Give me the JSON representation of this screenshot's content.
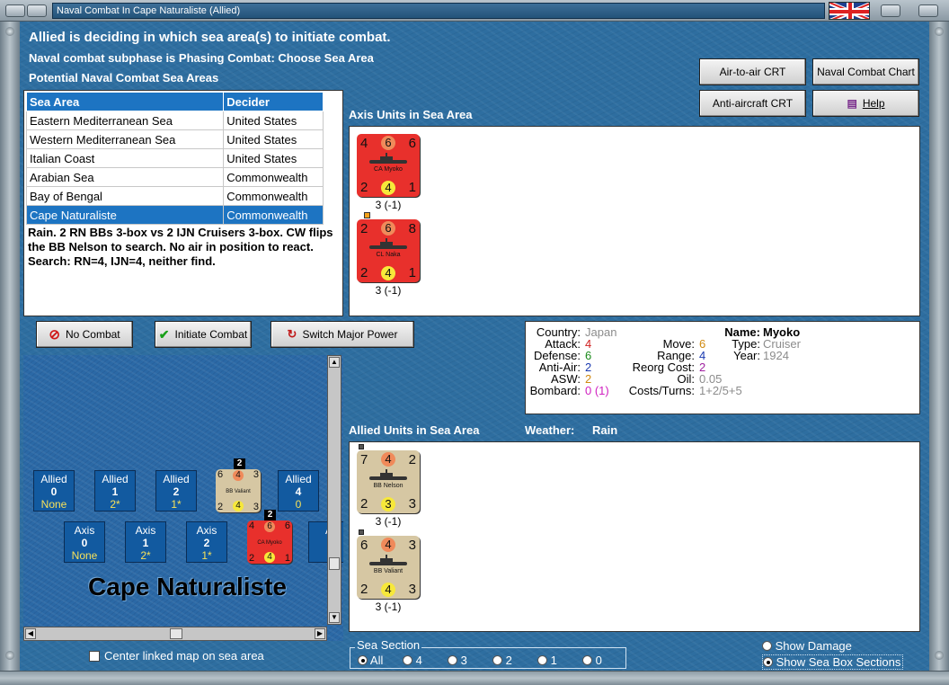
{
  "window": {
    "title": "Naval Combat In Cape Naturaliste (Allied)"
  },
  "header": {
    "line1": "Allied is deciding in which sea area(s) to initiate combat.",
    "line2": "Naval combat subphase is Phasing Combat: Choose Sea Area",
    "line3": "Potential Naval Combat Sea Areas"
  },
  "buttons": {
    "air_to_air": "Air-to-air CRT",
    "naval_chart": "Naval Combat Chart",
    "anti_aircraft": "Anti-aircraft CRT",
    "help": "Help",
    "no_combat": "No Combat",
    "initiate_combat": "Initiate Combat",
    "switch_major": "Switch Major Power"
  },
  "sea_table": {
    "headers": [
      "Sea Area",
      "Decider"
    ],
    "rows": [
      [
        "Eastern Mediterranean Sea",
        "United States"
      ],
      [
        "Western Mediterranean Sea",
        "United States"
      ],
      [
        "Italian Coast",
        "United States"
      ],
      [
        "Arabian Sea",
        "Commonwealth"
      ],
      [
        "Bay of Bengal",
        "Commonwealth"
      ],
      [
        "Cape Naturaliste",
        "Commonwealth"
      ]
    ],
    "selected_index": 5
  },
  "notes": "Rain.  2 RN BBs 3-box vs 2 IJN Cruisers 3-box.  CW flips the BB Nelson to search.  No air in position to react.  Search:  RN=4, IJN=4, neither find.",
  "axis_section": {
    "label": "Axis Units in Sea Area",
    "units": [
      {
        "tl": "4",
        "tc": "6",
        "tr": "6",
        "name": "CA Myoko",
        "bl": "2",
        "bc": "4",
        "br": "1",
        "strength": "3 (-1)"
      },
      {
        "tl": "2",
        "tc": "6",
        "tr": "8",
        "name": "CL Naka",
        "bl": "2",
        "bc": "4",
        "br": "1",
        "strength": "3 (-1)"
      }
    ]
  },
  "allied_section": {
    "label": "Allied Units in Sea Area",
    "weather_label": "Weather:",
    "weather_value": "Rain",
    "units": [
      {
        "tl": "7",
        "tc": "4",
        "tr": "2",
        "name": "BB Nelson",
        "bl": "2",
        "bc": "3",
        "br": "3",
        "strength": "3 (-1)"
      },
      {
        "tl": "6",
        "tc": "4",
        "tr": "3",
        "name": "BB Valiant",
        "bl": "2",
        "bc": "4",
        "br": "3",
        "strength": "3 (-1)"
      }
    ]
  },
  "unit_info": {
    "country_k": "Country:",
    "country_v": "Japan",
    "attack_k": "Attack:",
    "attack_v": "4",
    "defense_k": "Defense:",
    "defense_v": "6",
    "antiair_k": "Anti-Air:",
    "antiair_v": "2",
    "asw_k": "ASW:",
    "asw_v": "2",
    "bombard_k": "Bombard:",
    "bombard_v": "0 (1)",
    "move_k": "Move:",
    "move_v": "6",
    "range_k": "Range:",
    "range_v": "4",
    "reorg_k": "Reorg Cost:",
    "reorg_v": "2",
    "oil_k": "Oil:",
    "oil_v": "0.05",
    "costs_k": "Costs/Turns:",
    "costs_v": "1+2/5+5",
    "name_k": "Name:",
    "name_v": "Myoko",
    "type_k": "Type:",
    "type_v": "Cruiser",
    "year_k": "Year:",
    "year_v": "1924"
  },
  "map": {
    "sea_name": "Cape Naturaliste",
    "allied_boxes": [
      {
        "side": "Allied",
        "num": "0",
        "val": "None"
      },
      {
        "side": "Allied",
        "num": "1",
        "val": "2*"
      },
      {
        "side": "Allied",
        "num": "2",
        "val": "1*"
      },
      {
        "side": "Allied",
        "num": "4",
        "val": "0"
      }
    ],
    "axis_boxes": [
      {
        "side": "Axis",
        "num": "0",
        "val": "None"
      },
      {
        "side": "Axis",
        "num": "1",
        "val": "2*"
      },
      {
        "side": "Axis",
        "num": "2",
        "val": "1*"
      },
      {
        "side": "A",
        "num": "",
        "val": ""
      }
    ],
    "stack_count_allied": "2",
    "stack_count_axis": "2",
    "mini_allied": {
      "tl": "6",
      "tc": "4",
      "tr": "3",
      "name": "BB Valiant",
      "bl": "2",
      "bc": "4",
      "br": "3"
    },
    "mini_axis": {
      "tl": "4",
      "tc": "6",
      "tr": "6",
      "name": "CA Myoko",
      "bl": "2",
      "bc": "4",
      "br": "1"
    }
  },
  "center_checkbox": "Center linked map on sea area",
  "sea_section": {
    "label": "Sea Section",
    "options": [
      "All",
      "4",
      "3",
      "2",
      "1",
      "0"
    ],
    "selected": "All"
  },
  "show_damage": "Show Damage",
  "show_sea_box": "Show Sea Box Sections",
  "colors": {
    "axis_counter": "#e8302c",
    "allied_counter": "#d6c7a3",
    "selection": "#1d74c2",
    "circle_top": "#f08a5a",
    "circle_bottom": "#f7e83a"
  }
}
